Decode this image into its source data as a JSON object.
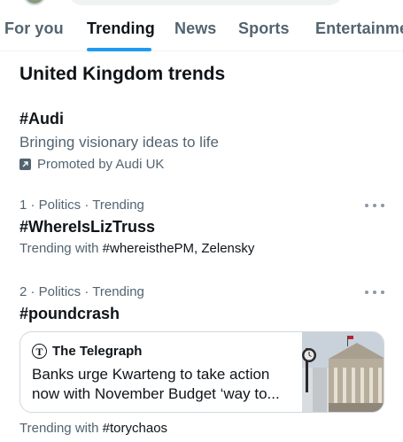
{
  "tabs": [
    {
      "label": "For you",
      "active": false
    },
    {
      "label": "Trending",
      "active": true
    },
    {
      "label": "News",
      "active": false
    },
    {
      "label": "Sports",
      "active": false
    },
    {
      "label": "Entertainme",
      "active": false
    }
  ],
  "section_title": "United Kingdom trends",
  "promoted": {
    "hashtag": "#Audi",
    "description": "Bringing visionary ideas to life",
    "promoted_by": "Promoted by Audi UK"
  },
  "trends": [
    {
      "rank": "1",
      "context": " · Politics · Trending",
      "hashtag": "#WhereIsLizTruss",
      "with_prefix": "Trending with ",
      "with_terms": "#whereisthePM, Zelensky"
    },
    {
      "rank": "2",
      "context": " · Politics · Trending",
      "hashtag": "#poundcrash",
      "with_prefix": "Trending with ",
      "with_terms": "#torychaos"
    }
  ],
  "news_card": {
    "source": "The Telegraph",
    "headline": "Banks urge Kwarteng to take action now with November Budget ‘way to...",
    "image": "bank-building-clock-photo"
  },
  "colors": {
    "accent": "#1d9bf0",
    "text_primary": "#0f1419",
    "text_secondary": "#536471",
    "border": "#cfd9de"
  }
}
